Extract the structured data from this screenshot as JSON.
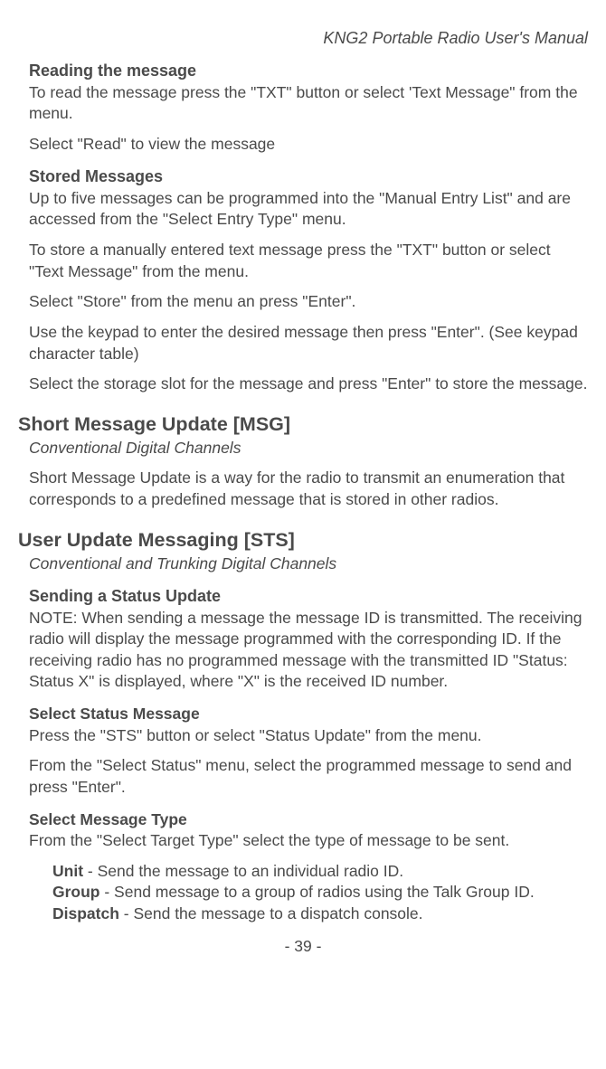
{
  "header": {
    "title": "KNG2 Portable Radio User's Manual"
  },
  "section1": {
    "heading": "Reading the message",
    "p1": "To read the message press the \"TXT\" button or select 'Text Message\" from the menu.",
    "p2": "Select \"Read\" to view the message"
  },
  "section2": {
    "heading": "Stored Messages",
    "p1": "Up to five messages can be programmed into the \"Manual Entry List\" and are accessed from the \"Select Entry Type\" menu.",
    "p2": "To store a manually entered text message press the \"TXT\" button or select \"Text Message\" from the menu.",
    "p3": "Select \"Store\" from the menu an press \"Enter\".",
    "p4": "Use the keypad to enter the desired message then press \"Enter\". (See keypad character table)",
    "p5": "Select the storage slot for the message and press \"Enter\" to store the message."
  },
  "section3": {
    "heading": "Short Message Update [MSG]",
    "subtitle": "Conventional Digital Channels",
    "p1": "Short Message Update is a way for the radio to transmit an enumeration that corresponds to a predefined message that is stored in other radios."
  },
  "section4": {
    "heading": "User Update Messaging [STS]",
    "subtitle": "Conventional and Trunking Digital Channels",
    "sub1": {
      "heading": "Sending a Status Update",
      "p1": "NOTE: When sending a message the message ID is transmitted. The receiving radio will display the message programmed with the corresponding ID. If the receiving radio has no programmed message with the transmitted ID \"Status: Status X\" is displayed, where \"X\" is the received ID number."
    },
    "sub2": {
      "heading": "Select Status Message",
      "p1": "Press the \"STS\" button or select \"Status Update\" from the menu.",
      "p2": "From the \"Select Status\" menu, select the programmed message to send and press \"Enter\"."
    },
    "sub3": {
      "heading": "Select Message Type",
      "p1": "From the \"Select Target Type\" select the type of message to be sent.",
      "items": [
        {
          "label": "Unit",
          "desc": " - Send the message to an individual radio ID."
        },
        {
          "label": "Group",
          "desc": " - Send message to a group of radios using the Talk Group ID."
        },
        {
          "label": "Dispatch",
          "desc": " - Send the message to a dispatch console."
        }
      ]
    }
  },
  "pageNumber": "- 39 -"
}
